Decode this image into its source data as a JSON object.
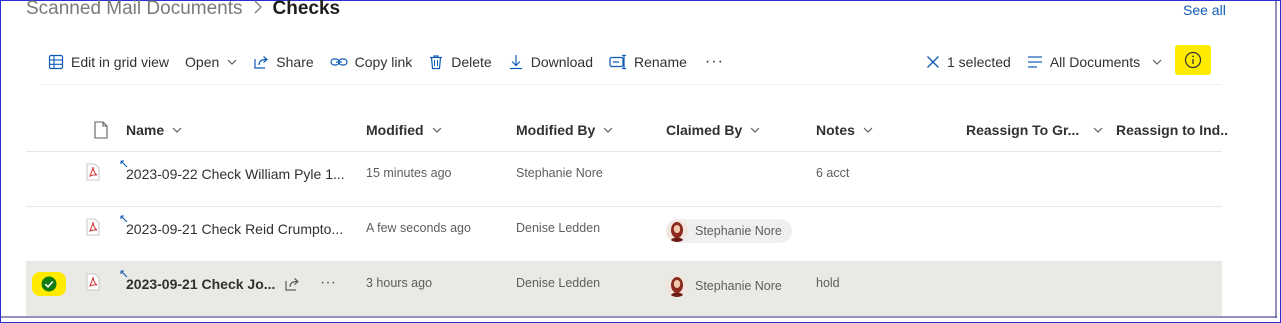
{
  "breadcrumb": {
    "parent": "Scanned Mail Documents",
    "current": "Checks"
  },
  "see_all": "See all",
  "toolbar": {
    "edit_grid": "Edit in grid view",
    "open": "Open",
    "share": "Share",
    "copy_link": "Copy link",
    "delete": "Delete",
    "download": "Download",
    "rename": "Rename",
    "more": "···",
    "selected_count": "1 selected",
    "view": "All Documents"
  },
  "columns": {
    "name": "Name",
    "modified": "Modified",
    "modified_by": "Modified By",
    "claimed_by": "Claimed By",
    "notes": "Notes",
    "reassign_group": "Reassign To Gr...",
    "reassign_ind": "Reassign to Ind.."
  },
  "rows": [
    {
      "name": "2023-09-22 Check William Pyle 1...",
      "modified": "15 minutes ago",
      "modified_by": "Stephanie Nore",
      "claimed_by": "",
      "notes": "6 acct"
    },
    {
      "name": "2023-09-21 Check Reid Crumpto...",
      "modified": "A few seconds ago",
      "modified_by": "Denise Ledden",
      "claimed_by": "Stephanie Nore",
      "notes": ""
    },
    {
      "name": "2023-09-21 Check Jo...",
      "modified": "3 hours ago",
      "modified_by": "Denise Ledden",
      "claimed_by": "Stephanie Nore",
      "notes": "hold"
    }
  ],
  "colors": {
    "accent": "#0f5bb5",
    "highlight": "#ffeb00",
    "selected_row": "#e9e9e5",
    "pdf_red": "#d13438"
  }
}
